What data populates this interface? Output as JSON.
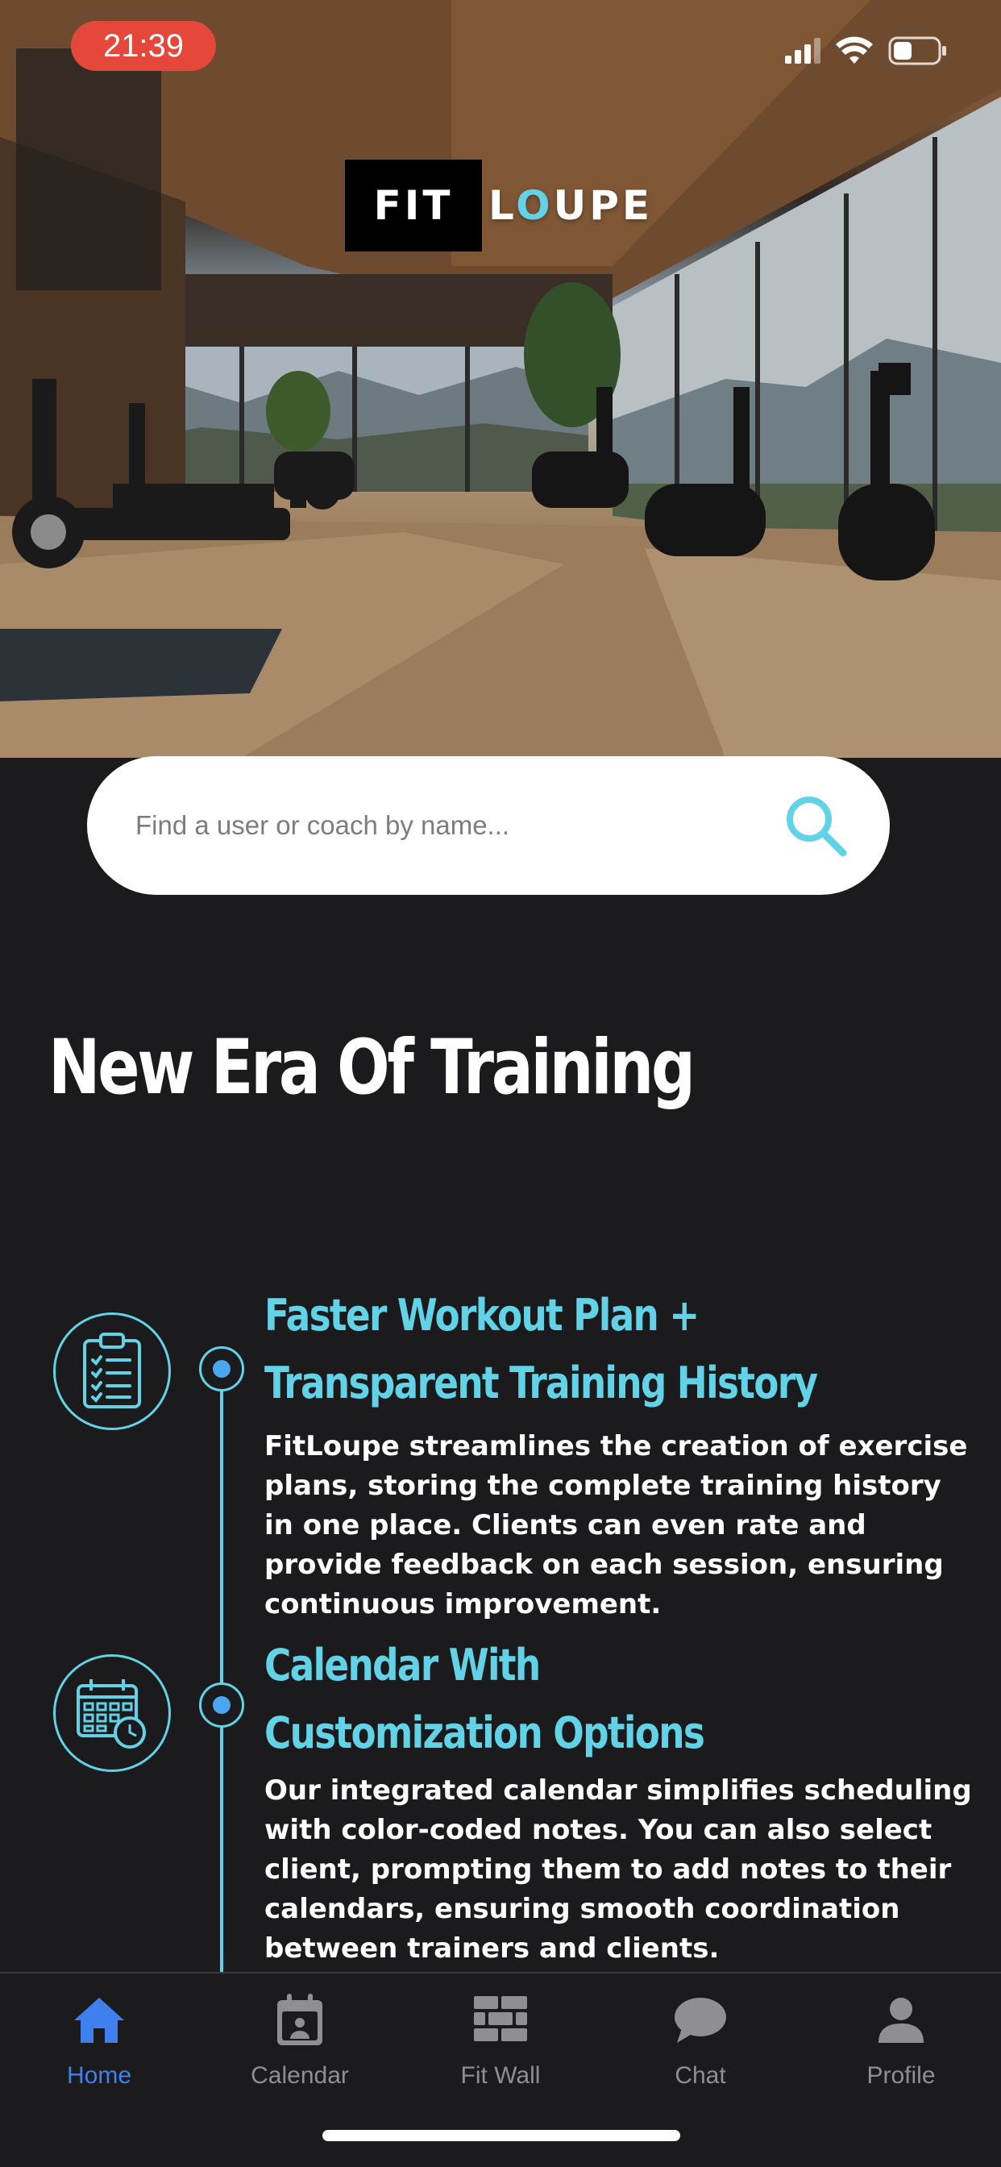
{
  "status_bar": {
    "time": "21:39",
    "icons": [
      "signal-icon",
      "wifi-icon",
      "battery-icon"
    ]
  },
  "logo": {
    "part1": "FIT",
    "part2_pre": "L",
    "part2_q": "O",
    "part2_post": "UPE"
  },
  "search": {
    "placeholder": "Find a user or coach by name...",
    "value": ""
  },
  "heading": "New Era Of Training",
  "features": [
    {
      "icon": "clipboard-checklist-icon",
      "title_line1": "Faster Workout Plan +",
      "title_line2": "Transparent Training History",
      "description": "FitLoupe streamlines the creation of exercise plans, storing the complete training history in one place. Clients can even rate and provide feedback on each session, ensuring continuous improvement."
    },
    {
      "icon": "calendar-clock-icon",
      "title_line1": "Calendar With",
      "title_line2": "Customization Options",
      "description": "Our integrated calendar simplifies scheduling with color-coded notes. You can also select client, prompting them to add notes to their calendars, ensuring smooth coordination between trainers and clients."
    }
  ],
  "tabs": [
    {
      "label": "Home",
      "icon": "home-icon",
      "active": true
    },
    {
      "label": "Calendar",
      "icon": "calendar-icon",
      "active": false
    },
    {
      "label": "Fit Wall",
      "icon": "brick-wall-icon",
      "active": false
    },
    {
      "label": "Chat",
      "icon": "chat-bubble-icon",
      "active": false
    },
    {
      "label": "Profile",
      "icon": "person-icon",
      "active": false
    }
  ],
  "colors": {
    "accent": "#62d2e6",
    "active_tab": "#3f7fee",
    "inactive_tab": "#8e8e93",
    "background": "#1b1b1d",
    "time_pill": "#e5473a"
  }
}
